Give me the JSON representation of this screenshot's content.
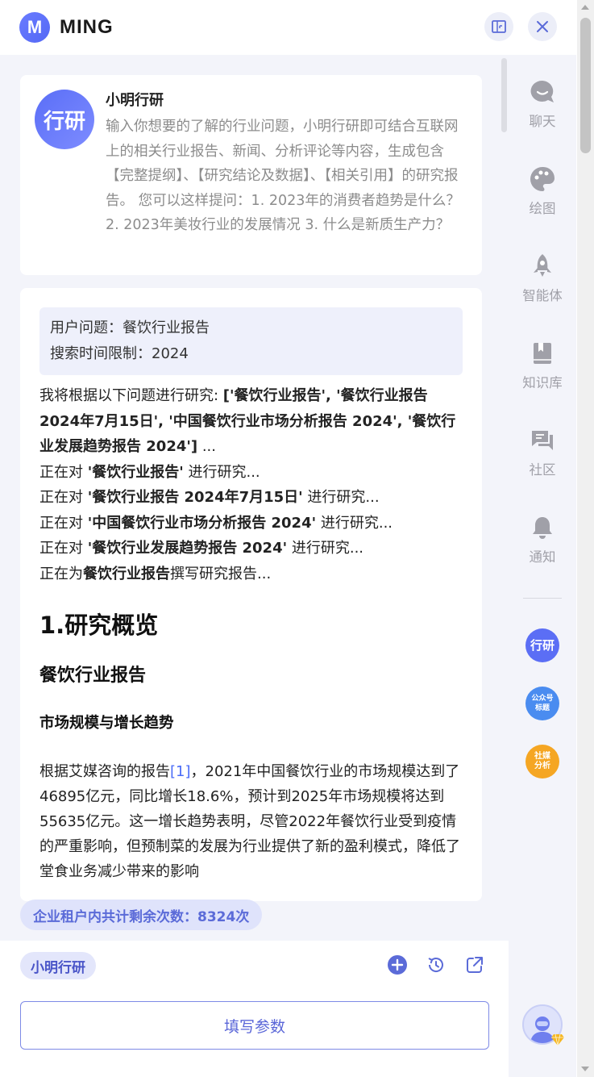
{
  "header": {
    "logo_letter": "M",
    "title": "MING"
  },
  "intro": {
    "avatar_text": "行研",
    "name": "小明行研",
    "description": "输入你想要的了解的行业问题，小明行研即可结合互联网上的相关行业报告、新闻、分析评论等内容，生成包含【完整提纲】、【研究结论及数据】、【相关引用】的研究报告。 您可以这样提问：1. 2023年的消费者趋势是什么？2. 2023年美妆行业的发展情况 3. 什么是新质生产力？"
  },
  "query": {
    "question": "用户问题：餐饮行业报告",
    "time_limit": "搜索时间限制：2024"
  },
  "progress": {
    "intro_prefix": "我将根据以下问题进行研究: ",
    "intro_list": "['餐饮行业报告', '餐饮行业报告 2024年7月15日', '中国餐饮行业市场分析报告 2024', '餐饮行业发展趋势报告 2024']",
    "intro_suffix": " ...",
    "steps": [
      {
        "prefix": "正在对 ",
        "topic": "'餐饮行业报告'",
        "suffix": " 进行研究..."
      },
      {
        "prefix": "正在对 ",
        "topic": "'餐饮行业报告 2024年7月15日'",
        "suffix": " 进行研究..."
      },
      {
        "prefix": "正在对 ",
        "topic": "'中国餐饮行业市场分析报告 2024'",
        "suffix": " 进行研究..."
      },
      {
        "prefix": "正在对 ",
        "topic": "'餐饮行业发展趋势报告 2024'",
        "suffix": " 进行研究..."
      }
    ],
    "writing_prefix": "正在为",
    "writing_topic": "餐饮行业报告",
    "writing_suffix": "撰写研究报告..."
  },
  "report": {
    "h1": "1.研究概览",
    "h2": "餐饮行业报告",
    "h3": "市场规模与增长趋势",
    "para_before_ref": "根据艾媒咨询的报告",
    "ref": "[1]",
    "para_after_ref": "，2021年中国餐饮行业的市场规模达到了46895亿元，同比增长18.6%，预计到2025年市场规模将达到55635亿元。这一增长趋势表明，尽管2022年餐饮行业受到疫情的严重影响，但预制菜的发展为行业提供了新的盈利模式，降低了堂食业务减少带来的影响"
  },
  "quota": "企业租户内共计剩余次数：8324次",
  "bottom": {
    "agent_chip": "小明行研",
    "params_button": "填写参数"
  },
  "sidebar": {
    "items": [
      {
        "label": "聊天",
        "icon": "chat-bubble-icon"
      },
      {
        "label": "绘图",
        "icon": "palette-icon"
      },
      {
        "label": "智能体",
        "icon": "rocket-icon"
      },
      {
        "label": "知识库",
        "icon": "book-icon"
      },
      {
        "label": "社区",
        "icon": "forum-icon"
      },
      {
        "label": "通知",
        "icon": "bell-icon"
      }
    ],
    "apps": [
      {
        "label": "行研",
        "color": "#5b6ef5"
      },
      {
        "label": "公众号\n标题",
        "color": "#4a8cf0"
      },
      {
        "label": "社媒\n分析",
        "color": "#f5a623"
      }
    ]
  },
  "colors": {
    "accent": "#5b6bd8",
    "sidebar_bg": "#f3f4fa",
    "icon_gray": "#a0a0a8"
  }
}
